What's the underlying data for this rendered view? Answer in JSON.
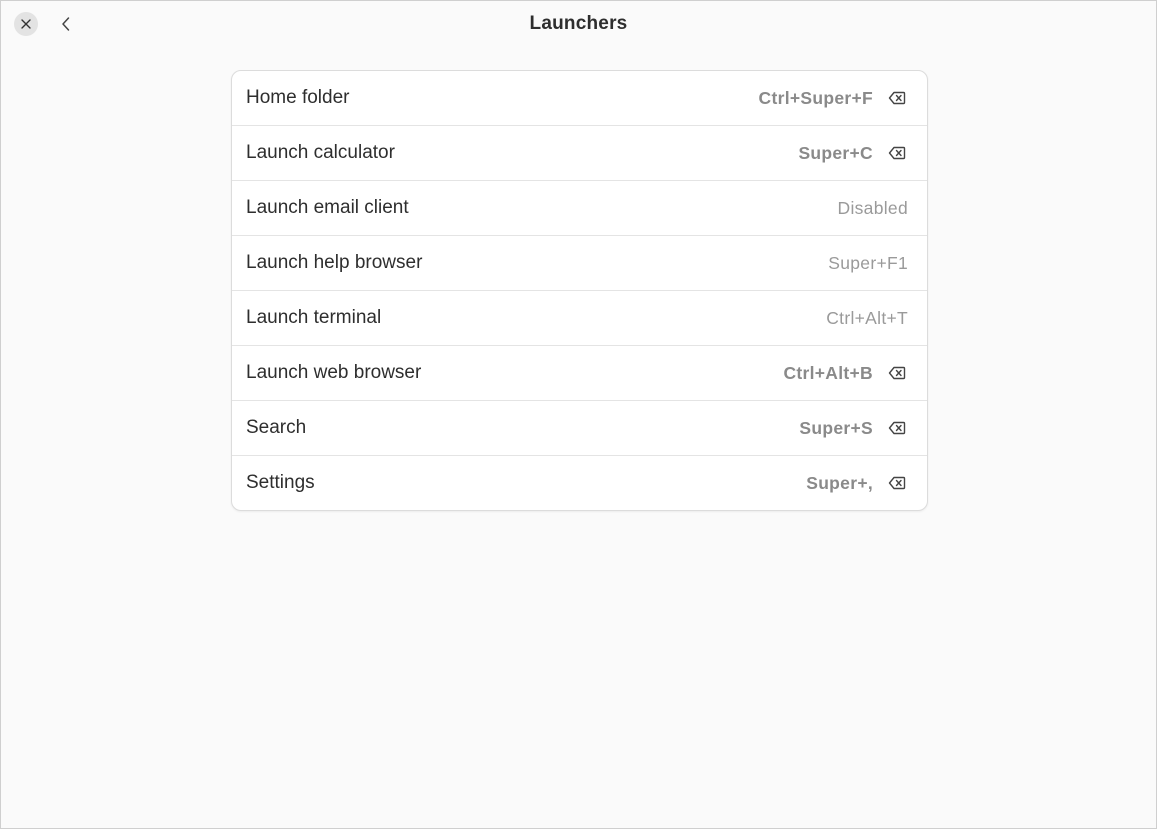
{
  "window": {
    "title": "Launchers"
  },
  "header": {
    "close_icon": "close-icon",
    "back_icon": "chevron-left-icon"
  },
  "shortcuts": [
    {
      "label": "Home folder",
      "accelerator": "Ctrl+Super+F",
      "custom": true
    },
    {
      "label": "Launch calculator",
      "accelerator": "Super+C",
      "custom": true
    },
    {
      "label": "Launch email client",
      "accelerator": "Disabled",
      "custom": false
    },
    {
      "label": "Launch help browser",
      "accelerator": "Super+F1",
      "custom": false
    },
    {
      "label": "Launch terminal",
      "accelerator": "Ctrl+Alt+T",
      "custom": false
    },
    {
      "label": "Launch web browser",
      "accelerator": "Ctrl+Alt+B",
      "custom": true
    },
    {
      "label": "Search",
      "accelerator": "Super+S",
      "custom": true
    },
    {
      "label": "Settings",
      "accelerator": "Super+,",
      "custom": true
    }
  ],
  "colors": {
    "background": "#fafafa",
    "card": "#ffffff",
    "text": "#2e2e2e",
    "dim_text": "#9a9a9a"
  }
}
